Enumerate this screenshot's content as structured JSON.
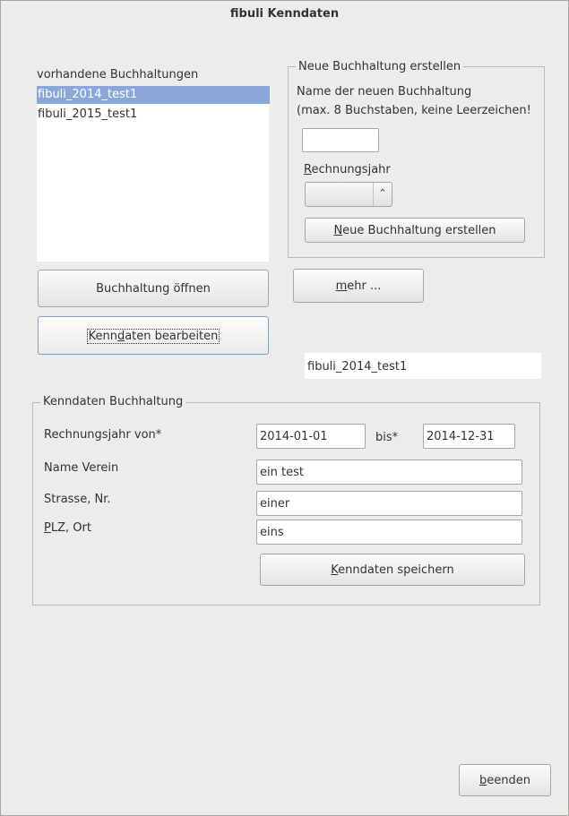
{
  "window": {
    "title": "fibuli Kenndaten"
  },
  "existing": {
    "label": "vorhandene Buchhaltungen",
    "items": [
      "fibuli_2014_test1",
      "fibuli_2015_test1"
    ],
    "selected_index": 0
  },
  "new_group": {
    "legend": "Neue Buchhaltung erstellen",
    "hint_line1": "Name der neuen Buchhaltung",
    "hint_line2": "(max. 8 Buchstaben, keine Leerzeichen!",
    "name_value": "",
    "year_label_mnemonic": "R",
    "year_label_rest": "echnungsjahr",
    "year_value": "",
    "create_button_mnemonic": "N",
    "create_button_rest": "eue Buchhaltung erstellen"
  },
  "actions": {
    "open_label": "Buchhaltung öffnen",
    "edit_label_pre": "Kenn",
    "edit_label_mnemonic": "d",
    "edit_label_post": "aten bearbeiten",
    "more_label_mnemonic": "m",
    "more_label_rest": "ehr ..."
  },
  "current_name": "fibuli_2014_test1",
  "details": {
    "legend": "Kenndaten Buchhaltung",
    "year_from_label": "Rechnungsjahr von*",
    "year_from_value": "2014-01-01",
    "to_label": "bis*",
    "year_to_value": "2014-12-31",
    "name_label": "Name Verein",
    "name_value": "ein test",
    "street_label": "Strasse, Nr.",
    "street_value": "einer",
    "city_label_mnemonic": "P",
    "city_label_rest": "LZ, Ort",
    "city_value": "eins",
    "save_label_mnemonic": "K",
    "save_label_rest": "enndaten speichern"
  },
  "footer": {
    "quit_label_mnemonic": "b",
    "quit_label_rest": "eenden"
  }
}
